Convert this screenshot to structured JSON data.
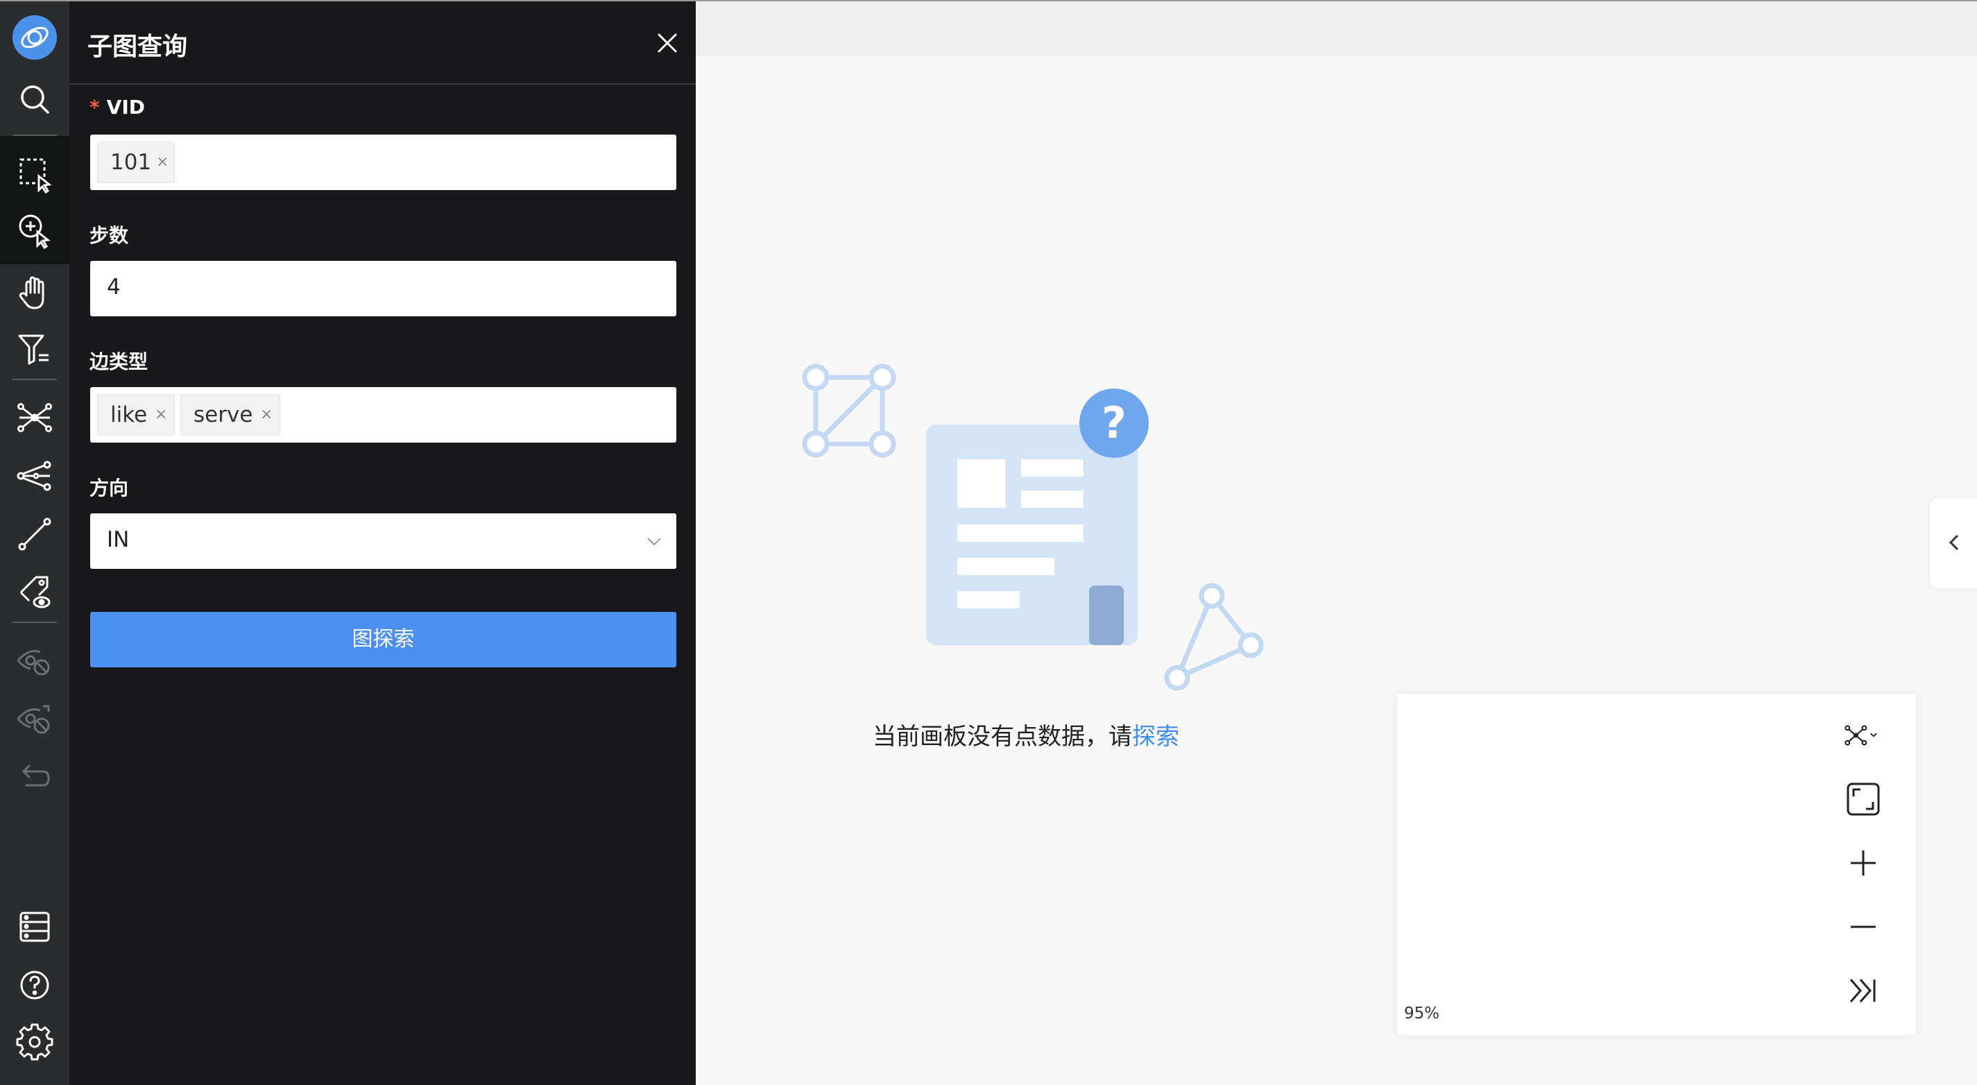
{
  "panel": {
    "title": "子图查询",
    "vid": {
      "required_mark": "*",
      "label": "VID",
      "tags": [
        "101"
      ]
    },
    "steps": {
      "label": "步数",
      "value": "4"
    },
    "edge_type": {
      "label": "边类型",
      "tags": [
        "like",
        "serve"
      ]
    },
    "direction": {
      "label": "方向",
      "selected": "IN"
    },
    "submit_label": "图探索",
    "tag_remove_glyph": "×"
  },
  "canvas": {
    "empty_text": "当前画板没有点数据，请",
    "empty_link": "探索",
    "zoom": "95%"
  },
  "colors": {
    "accent": "#4c91f1",
    "link": "#3f8ef0",
    "required": "#f25b4b",
    "toolbar_bg": "#2b2c2e",
    "panel_bg": "#18181a"
  },
  "toolbar_icons": [
    "logo-icon",
    "search-icon",
    "box-select-icon",
    "expand-icon",
    "pan-hand-icon",
    "filter-icon",
    "subgraph-icon",
    "path-icon",
    "edge-line-icon",
    "tag-view-icon",
    "hide-icon",
    "reveal-icon",
    "undo-icon",
    "list-icon",
    "help-icon",
    "settings-icon"
  ],
  "minimap_icons": [
    "layout-icon",
    "fit-view-icon",
    "zoom-in-icon",
    "zoom-out-icon",
    "collapse-icon"
  ]
}
